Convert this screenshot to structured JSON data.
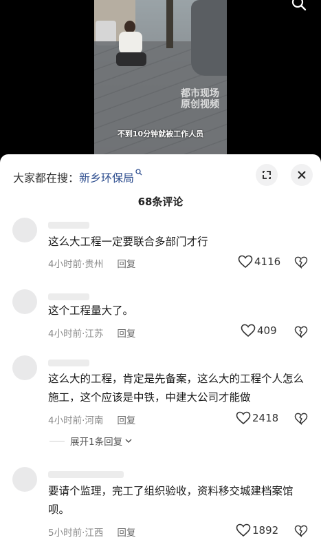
{
  "video": {
    "title_overlay": "",
    "watermark_lines": [
      "都市现场",
      "原创视频"
    ],
    "subtitle": "不到10分钟就被工作人员"
  },
  "search_bar": {
    "prefix": "大家都在搜：",
    "query": "新乡环保局"
  },
  "comment_count": "68条评论",
  "comments": [
    {
      "text": "这么大工程一定要联合多部门才行",
      "time": "4小时前",
      "location": "贵州",
      "reply_label": "回复",
      "likes": "4116"
    },
    {
      "text": "这个工程量大了。",
      "time": "4小时前",
      "location": "江苏",
      "reply_label": "回复",
      "likes": "409"
    },
    {
      "text": "这么大的工程，肯定是先备案，这么大的工程个人怎么施工，这个应该是中铁，中建大公司才能做",
      "time": "4小时前",
      "location": "河南",
      "reply_label": "回复",
      "likes": "2418",
      "expand_label": "展开1条回复"
    },
    {
      "text": "要请个监理，完工了组织验收，资料移交城建档案馆呗。",
      "time": "5小时前",
      "location": "江西",
      "reply_label": "回复",
      "likes": "1892"
    }
  ],
  "colors": {
    "accent_link": "#2e4e8f",
    "meta_gray": "#8a8a8a"
  }
}
